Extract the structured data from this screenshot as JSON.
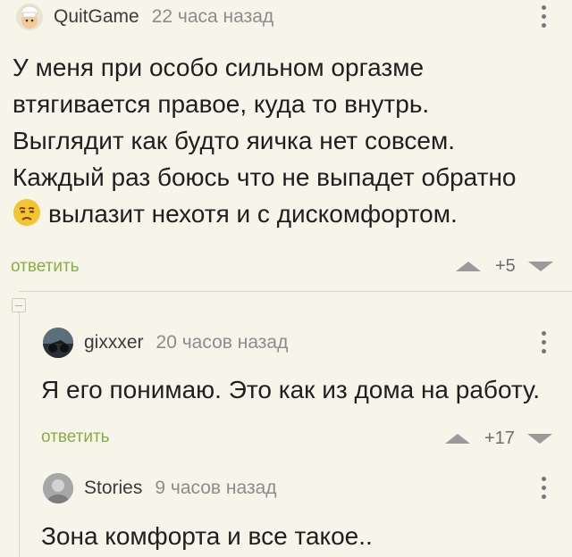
{
  "comments": [
    {
      "author": "QuitGame",
      "time": "22 часа назад",
      "text_lines": [
        "У меня при особо сильном оргазме",
        "втягивается правое, куда то внутрь.",
        "Выглядит как будто яичка нет совсем.",
        "Каждый раз боюсь что не выпадет обратно"
      ],
      "emoji_icon": "unamused-face-icon",
      "text_last": "вылазит нехотя и с дискомфортом.",
      "reply_label": "ответить",
      "score": "+5"
    },
    {
      "author": "gixxxer",
      "time": "20 часов назад",
      "text": "Я его понимаю. Это как из дома на работу.",
      "reply_label": "ответить",
      "score": "+17"
    },
    {
      "author": "Stories",
      "time": "9 часов назад",
      "text": "Зона комфорта и все такое.."
    }
  ],
  "colors": {
    "background": "#f7f4ea",
    "reply_link": "#8aac45",
    "vote_arrow": "#9a9a9a"
  }
}
